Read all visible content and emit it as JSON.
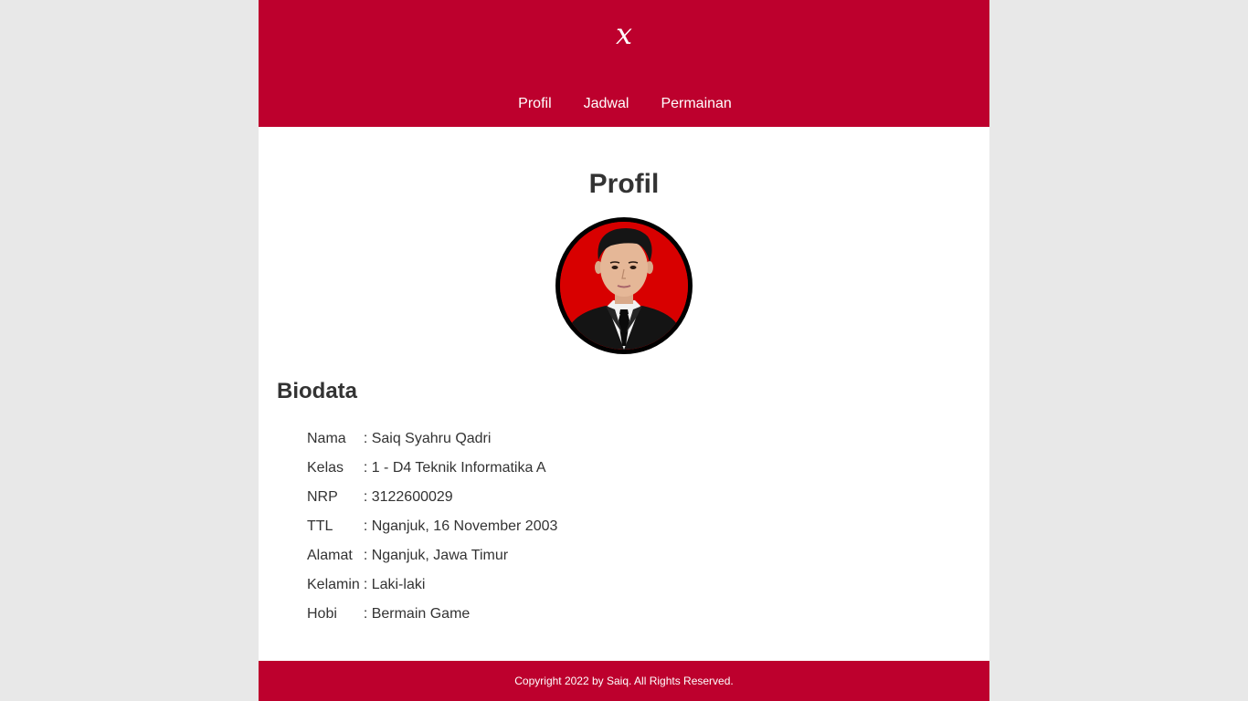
{
  "header": {
    "logo": "x",
    "nav": [
      {
        "label": "Profil"
      },
      {
        "label": "Jadwal"
      },
      {
        "label": "Permainan"
      }
    ]
  },
  "main": {
    "title": "Profil",
    "biodata_title": "Biodata",
    "biodata": [
      {
        "label": "Nama",
        "value": ": Saiq Syahru Qadri"
      },
      {
        "label": "Kelas",
        "value": ": 1 - D4 Teknik Informatika A"
      },
      {
        "label": "NRP",
        "value": ": 3122600029"
      },
      {
        "label": "TTL",
        "value": ": Nganjuk, 16 November 2003"
      },
      {
        "label": "Alamat",
        "value": ": Nganjuk, Jawa Timur"
      },
      {
        "label": "Kelamin",
        "value": ": Laki-laki"
      },
      {
        "label": "Hobi",
        "value": ": Bermain Game"
      }
    ]
  },
  "footer": {
    "text": "Copyright 2022 by Saiq. All Rights Reserved."
  },
  "colors": {
    "brand": "#bd002d",
    "page_bg": "#e8e8e8",
    "text": "#333333",
    "photo_bg": "#d80000"
  }
}
